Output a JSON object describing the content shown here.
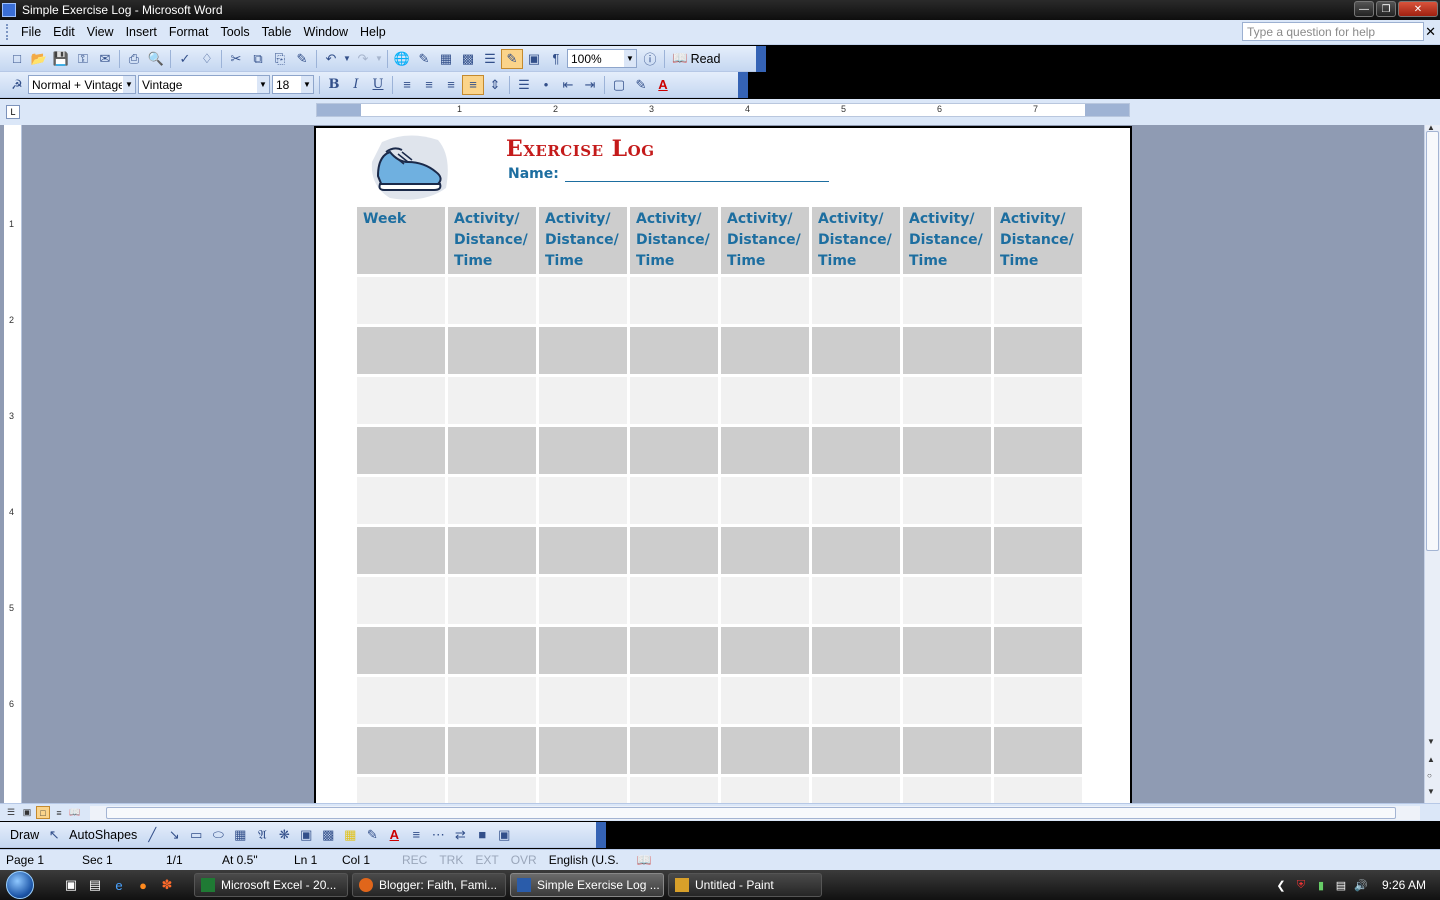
{
  "window": {
    "title": "Simple Exercise Log - Microsoft Word"
  },
  "menu": [
    "File",
    "Edit",
    "View",
    "Insert",
    "Format",
    "Tools",
    "Table",
    "Window",
    "Help"
  ],
  "help": {
    "placeholder": "Type a question for help"
  },
  "toolbar": {
    "zoom": "100%",
    "read_label": "Read"
  },
  "formatting": {
    "style": "Normal + Vintage",
    "font": "Vintage",
    "size": "18",
    "bold": "B",
    "italic": "I",
    "underline": "U",
    "font_color_glyph": "A"
  },
  "ruler": {
    "numbers": [
      "1",
      "2",
      "3",
      "4",
      "5",
      "6",
      "7"
    ],
    "vertical_numbers": [
      "1",
      "2",
      "3",
      "4",
      "5",
      "6"
    ]
  },
  "document": {
    "title": "Exercise Log",
    "name_label": "Name:",
    "headers": [
      "Week",
      "Activity/ Distance/ Time",
      "Activity/ Distance/ Time",
      "Activity/ Distance/ Time",
      "Activity/ Distance/ Time",
      "Activity/ Distance/ Time",
      "Activity/ Distance/ Time",
      "Activity/ Distance/ Time"
    ],
    "row_count": 11
  },
  "drawbar": {
    "draw_label": "Draw",
    "autoshapes_label": "AutoShapes"
  },
  "status": {
    "page": "Page 1",
    "sec": "Sec 1",
    "pages": "1/1",
    "at": "At 0.5\"",
    "ln": "Ln 1",
    "col": "Col 1",
    "rec": "REC",
    "trk": "TRK",
    "ext": "EXT",
    "ovr": "OVR",
    "lang": "English (U.S."
  },
  "taskbar": {
    "tasks": [
      {
        "label": "Microsoft Excel - 20...",
        "color": "#1f7a34"
      },
      {
        "label": "Blogger: Faith, Fami...",
        "color": "#e0661b"
      },
      {
        "label": "Simple Exercise Log ...",
        "color": "#2a5caa"
      },
      {
        "label": "Untitled - Paint",
        "color": "#d8a02a"
      }
    ],
    "clock": "9:26 AM"
  }
}
